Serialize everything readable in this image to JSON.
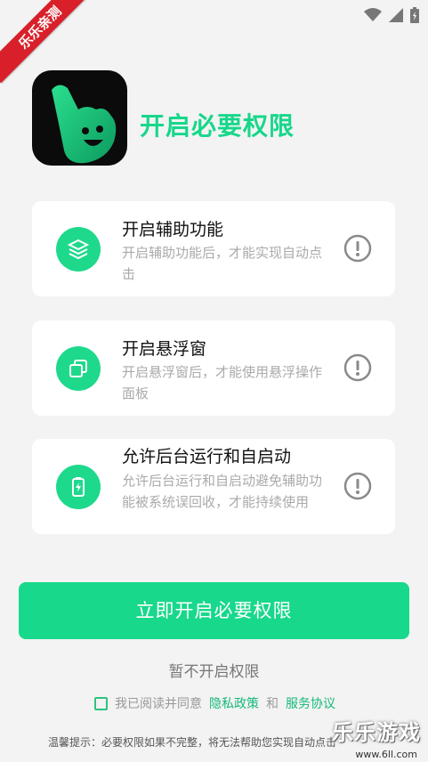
{
  "ribbon": {
    "label": "乐乐亲测"
  },
  "header": {
    "title": "开启必要权限"
  },
  "cards": [
    {
      "title": "开启辅助功能",
      "desc": "开启辅助功能后，才能实现自动点击"
    },
    {
      "title": "开启悬浮窗",
      "desc": "开启悬浮窗后，才能使用悬浮操作面板"
    },
    {
      "title": "允许后台运行和自启动",
      "desc": "允许后台运行和自启动避免辅助功能被系统误回收，才能持续使用"
    }
  ],
  "primary_button": {
    "label": "立即开启必要权限"
  },
  "skip_link": {
    "label": "暂不开启权限"
  },
  "agreement": {
    "prefix": "我已阅读并同意",
    "privacy": "隐私政策",
    "and": "和",
    "service": "服务协议"
  },
  "hint": "温馨提示：必要权限如果不完整，将无法帮助您实现自动点击",
  "watermark": {
    "brand": "乐乐游戏",
    "url": "www.6ll.com"
  },
  "colors": {
    "accent": "#18d88b",
    "ribbon": "#d9202a"
  }
}
